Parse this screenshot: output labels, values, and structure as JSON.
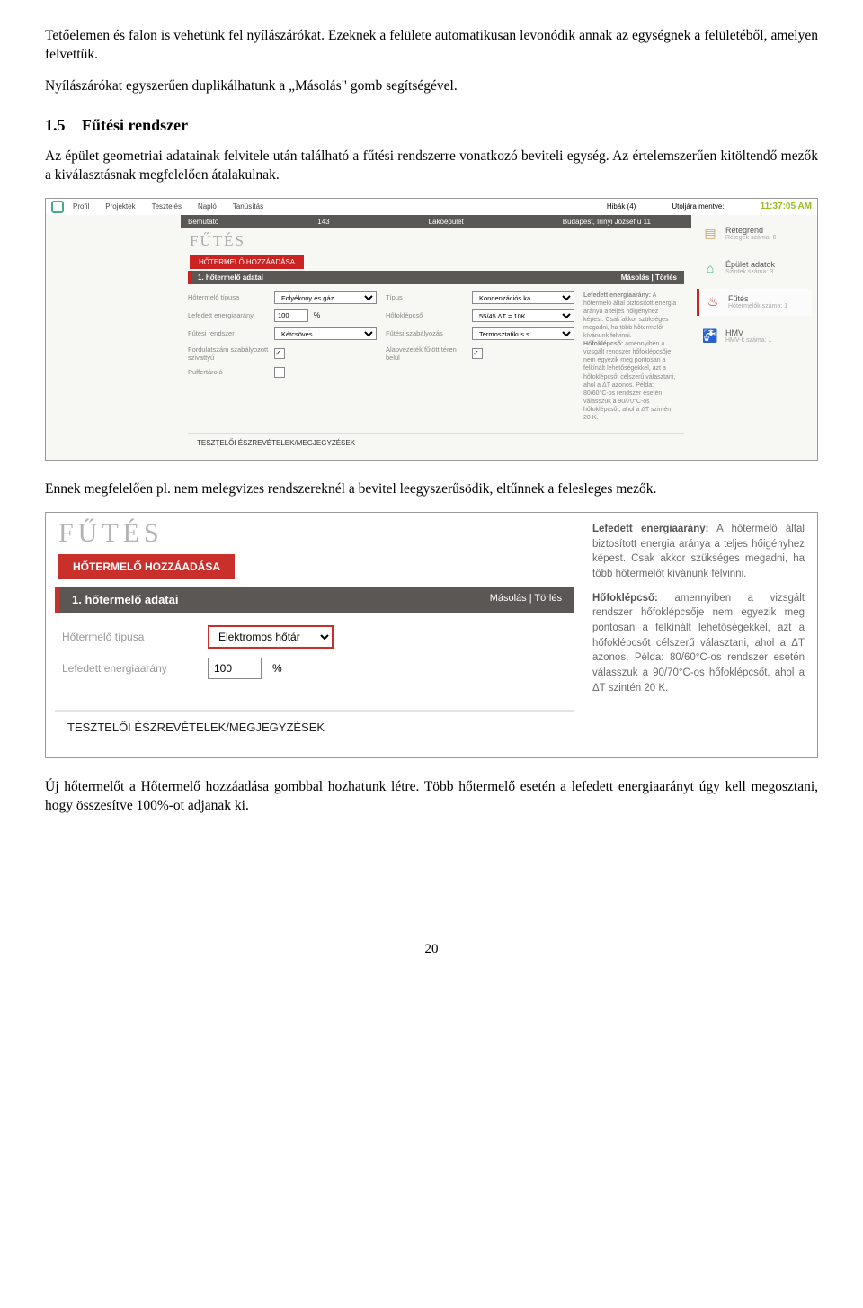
{
  "p1": "Tetőelemen és falon is vehetünk fel nyílászárókat. Ezeknek a felülete automatikusan levonódik annak az egységnek a felületéből, amelyen felvettük.",
  "p2": "Nyílászárókat egyszerűen duplikálhatunk a „Másolás\" gomb segítségével.",
  "h": {
    "num": "1.5",
    "text": "Fűtési rendszer"
  },
  "p3": "Az épület geometriai adatainak felvitele után található a fűtési rendszerre vonatkozó beviteli egység. Az értelemszerűen kitöltendő mezők a kiválasztásnak megfelelően átalakulnak.",
  "p4": "Ennek megfelelően pl. nem melegvizes rendszereknél a bevitel leegyszerűsödik, eltűnnek a felesleges mezők.",
  "p5": "Új hőtermelőt a Hőtermelő hozzáadása gombbal hozhatunk létre. Több hőtermelő esetén a lefedett energiaarányt úgy kell megosztani, hogy összesítve 100%-ot adjanak ki.",
  "pageNumber": "20",
  "s1": {
    "nav": [
      "Profil",
      "Projektek",
      "Tesztelés",
      "Napló",
      "Tanúsítás"
    ],
    "errors": "Hibák (4)",
    "savedLabel": "Utoljára mentve:",
    "time": "11:37:05 AM",
    "bar": [
      "Bemutató",
      "143",
      "Lakóépület",
      "Budapest, Irínyi József u 11"
    ],
    "title": "FŰTÉS",
    "add": "HŐTERMELŐ HOZZÁADÁSA",
    "sub": "1. hőtermelő adatai",
    "subR": "Másolás  |  Törlés",
    "f": {
      "l1": "Hőtermelő típusa",
      "v1": "Folyékony és gáz",
      "l2": "Lefedett energiaarány",
      "v2": "100",
      "u2": "%",
      "l3": "Fűtési rendszer",
      "v3": "Kétcsöves",
      "l4": "Fordulatszám szabályozott szivattyú",
      "l5": "Puffertároló",
      "l6": "Típus",
      "v6": "Kondenzációs ka",
      "l7": "Hőfoklépcső",
      "v7": "55/45 ΔT = 10K",
      "l8": "Fűtési szabályozás",
      "v8": "Termosztatikus s",
      "l9": "Alapvezeték fűtött téren belül"
    },
    "info1b": "Lefedett energiaarány:",
    "info1": " A hőtermelő által biztosított energia aránya a teljes hőigényhez képest. Csak akkor szükséges megadni, ha több hőtermelőt kívánunk felvinni.",
    "info2b": "Hőfoklépcső:",
    "info2": " amennyiben a vizsgált rendszer hőfoklépcsője nem egyezik meg pontosan a felkínált lehetőségekkel, azt a hőfoklépcsőt célszerű választani, ahol a ΔT azonos. Példa: 80/60°C-os rendszer esetén válasszuk a 90/70°C-os hőfoklépcsőt, ahol a ΔT szintén 20 K.",
    "note": "TESZTELŐI ÉSZREVÉTELEK/MEGJEGYZÉSEK",
    "side": {
      "c1t": "Rétegrend",
      "c1s": "Rétegek száma: 6",
      "c2t": "Épület adatok",
      "c2s": "Szintek száma: 3",
      "c3t": "Fűtés",
      "c3s": "Hőtermelők száma: 1",
      "c4t": "HMV",
      "c4s": "HMV-k száma: 1"
    }
  },
  "s2": {
    "title": "FŰTÉS",
    "add": "HŐTERMELŐ HOZZÁADÁSA",
    "sub": "1. hőtermelő adatai",
    "subR": "Másolás  |  Törlés",
    "l1": "Hőtermelő típusa",
    "v1": "Elektromos hőtár",
    "l2": "Lefedett energiaarány",
    "v2": "100",
    "u2": "%",
    "note": "TESZTELŐI ÉSZREVÉTELEK/MEGJEGYZÉSEK",
    "info1b": "Lefedett energiaarány:",
    "info1": " A hőtermelő által biztosított energia aránya a teljes hőigényhez képest. Csak akkor szükséges megadni, ha több hőtermelőt kívánunk felvinni.",
    "info2b": "Hőfoklépcső:",
    "info2": " amennyiben a vizsgált rendszer hőfoklépcsője nem egyezik meg pontosan a felkínált lehetőségekkel, azt a hőfoklépcsőt célszerű választani, ahol a ΔT azonos. Példa: 80/60°C-os rendszer esetén válasszuk a 90/70°C-os hőfoklépcsőt, ahol a ΔT szintén 20 K."
  }
}
